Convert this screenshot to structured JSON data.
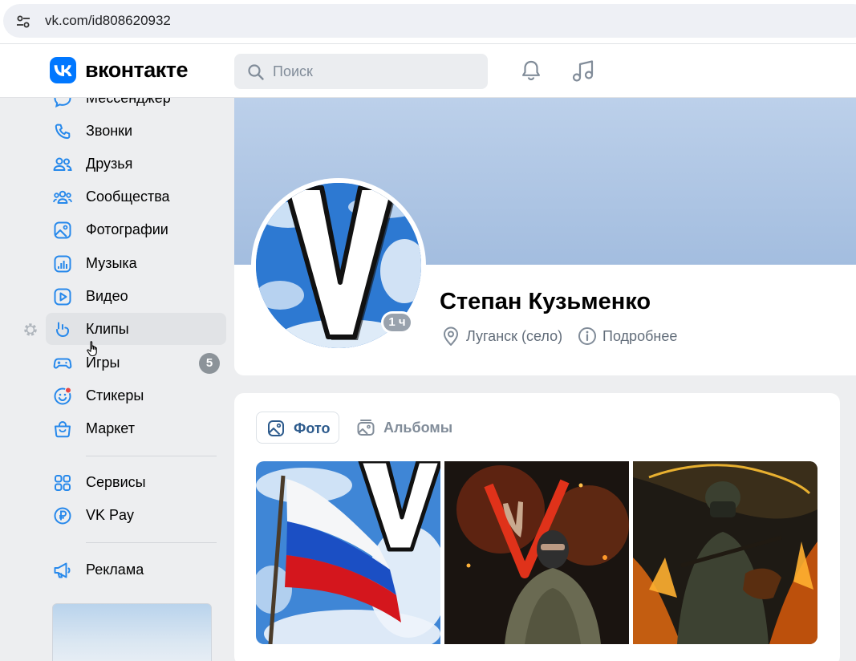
{
  "browser": {
    "url": "vk.com/id808620932",
    "tune_icon": "site-settings-icon"
  },
  "header": {
    "logo_text": "вконтакте",
    "search_placeholder": "Поиск",
    "icons": [
      "bell-icon",
      "music-note-icon"
    ]
  },
  "sidebar": {
    "items": [
      {
        "label": "Мессенджер",
        "icon": "message-icon"
      },
      {
        "label": "Звонки",
        "icon": "phone-icon"
      },
      {
        "label": "Друзья",
        "icon": "friends-icon"
      },
      {
        "label": "Сообщества",
        "icon": "communities-icon"
      },
      {
        "label": "Фотографии",
        "icon": "photos-icon"
      },
      {
        "label": "Музыка",
        "icon": "music-icon"
      },
      {
        "label": "Видео",
        "icon": "video-icon"
      },
      {
        "label": "Клипы",
        "icon": "clips-icon",
        "active": true
      },
      {
        "label": "Игры",
        "icon": "games-icon",
        "badge": "5"
      },
      {
        "label": "Стикеры",
        "icon": "stickers-icon"
      },
      {
        "label": "Маркет",
        "icon": "market-icon"
      },
      {
        "label": "Сервисы",
        "icon": "services-icon"
      },
      {
        "label": "VK Pay",
        "icon": "vkpay-icon"
      },
      {
        "label": "Реклама",
        "icon": "megaphone-icon"
      }
    ]
  },
  "profile": {
    "name": "Степан Кузьменко",
    "online_status": "1 ч",
    "location": "Луганск (село)",
    "details_label": "Подробнее"
  },
  "photos": {
    "tabs": [
      {
        "label": "Фото",
        "active": true
      },
      {
        "label": "Альбомы",
        "active": false
      }
    ]
  },
  "colors": {
    "accent": "#0077ff",
    "background": "#edeef0",
    "badge": "#8c9399",
    "secondary_text": "#626d7a",
    "stickers_dot": "#e64646"
  }
}
